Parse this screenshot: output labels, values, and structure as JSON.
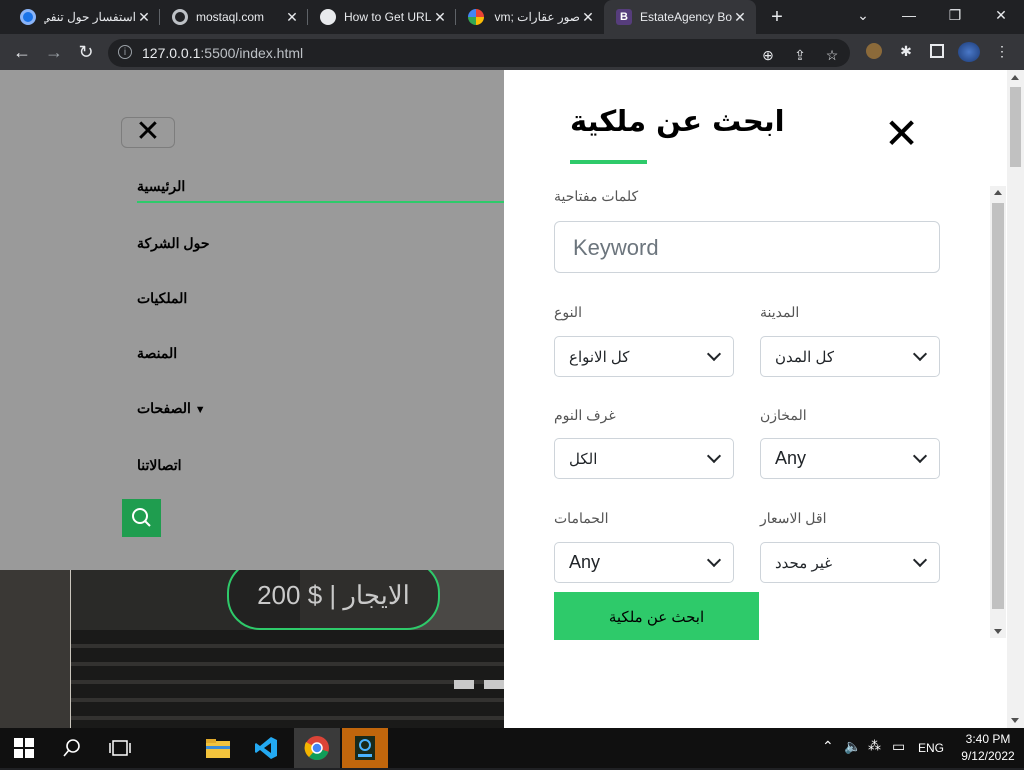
{
  "browser": {
    "tabs": [
      {
        "title": "استفسار حول تنفي",
        "favicon": "circle-blue-icon",
        "active": false
      },
      {
        "title": "mostaql.com",
        "favicon": "circle-grey-icon",
        "active": false
      },
      {
        "title": "How to Get URL",
        "favicon": "globe-icon",
        "active": false
      },
      {
        "title": "صور عقارات ;vm",
        "favicon": "google-icon",
        "active": false
      },
      {
        "title": "EstateAgency Bo",
        "favicon": "bootstrap-icon",
        "active": true
      }
    ],
    "url_host": "127.0.0.1",
    "url_rest": ":5500/index.html",
    "new_tab": "+",
    "close_glyph": "✕"
  },
  "nav_menu": {
    "close_glyph": "✕",
    "items": [
      "الرئيسية",
      "حول الشركة",
      "الملكيات",
      "المنصة",
      "الصفحات",
      "اتصالاتنا"
    ],
    "active_index": 0,
    "dropdown_index": 4
  },
  "hero": {
    "price": "الايجار | $ 200"
  },
  "search_panel": {
    "title": "ابحث عن ملكية",
    "keyword_label": "كلمات مفتاحية",
    "keyword_placeholder": "Keyword",
    "type_label": "النوع",
    "type_value": "كل الانواع",
    "city_label": "المدينة",
    "city_value": "كل المدن",
    "bedrooms_label": "غرف النوم",
    "bedrooms_value": "الكل",
    "garages_label": "المخازن",
    "garages_value": "Any",
    "bathrooms_label": "الحمامات",
    "bathrooms_value": "Any",
    "min_price_label": "اقل الاسعار",
    "min_price_value": "غير محدد",
    "submit_label": "ابحث عن ملكية"
  },
  "taskbar": {
    "time": "3:40 PM",
    "date": "9/12/2022",
    "lang": "ENG"
  },
  "colors": {
    "accent": "#2eca6a",
    "overlay": "#9a9a9a",
    "taskbar": "#101010"
  }
}
